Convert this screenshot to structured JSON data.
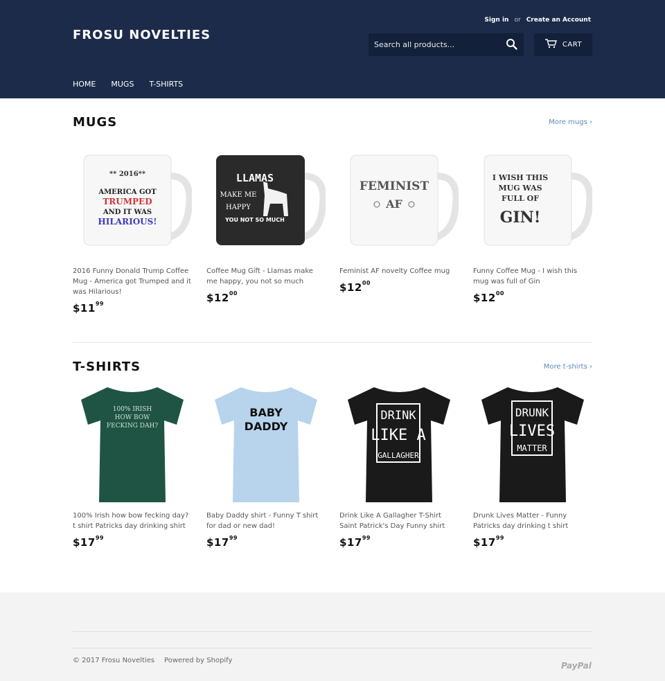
{
  "header": {
    "logo": "FROSU NOVELTIES",
    "sign_in": "Sign in",
    "or": "or",
    "create_account": "Create an Account",
    "search_placeholder": "Search all products...",
    "cart_label": "CART"
  },
  "nav": [
    "HOME",
    "MUGS",
    "T-SHIRTS"
  ],
  "mugs": {
    "title": "MUGS",
    "more": "More mugs ›",
    "products": [
      {
        "title": "2016 Funny Donald Trump Coffee Mug - America got Trumped and it was Hilarious!",
        "price_main": "$11",
        "price_cents": "99",
        "print": [
          "** 2016**",
          "AMERICA GOT",
          "TRUMPED",
          "AND IT WAS",
          "HILARIOUS!"
        ]
      },
      {
        "title": "Coffee Mug Gift - Llamas make me happy, you not so much",
        "price_main": "$12",
        "price_cents": "00",
        "print": [
          "LLAMAS",
          "MAKE ME",
          "HAPPY",
          "YOU NOT SO MUCH"
        ]
      },
      {
        "title": "Feminist AF novelty Coffee mug",
        "price_main": "$12",
        "price_cents": "00",
        "print": [
          "FEMINIST",
          "AF"
        ]
      },
      {
        "title": "Funny Coffee Mug - I wish this mug was full of Gin",
        "price_main": "$12",
        "price_cents": "00",
        "print": [
          "I WISH THIS",
          "MUG WAS",
          "FULL OF",
          "GIN!"
        ]
      }
    ]
  },
  "tshirts": {
    "title": "T-SHIRTS",
    "more": "More t-shirts ›",
    "products": [
      {
        "title": "100% Irish how bow fecking day? t shirt Patricks day drinking shirt",
        "price_main": "$17",
        "price_cents": "99",
        "color": "#1f5444",
        "print": [
          "100% IRISH",
          "HOW BOW",
          "FECKING DAH?"
        ]
      },
      {
        "title": "Baby Daddy shirt - Funny T shirt for dad or new dad!",
        "price_main": "$17",
        "price_cents": "99",
        "color": "#b8d4ec",
        "print": [
          "BABY",
          "DADDY"
        ]
      },
      {
        "title": "Drink Like A Gallagher T-Shirt Saint Patrick's Day Funny shirt",
        "price_main": "$17",
        "price_cents": "99",
        "color": "#1a1a1a",
        "print": [
          "DRINK",
          "LIKE A",
          "GALLAGHER"
        ]
      },
      {
        "title": "Drunk Lives Matter - Funny Patricks day drinking t shirt",
        "price_main": "$17",
        "price_cents": "99",
        "color": "#1a1a1a",
        "print": [
          "DRUNK",
          "LIVES",
          "MATTER"
        ]
      }
    ]
  },
  "footer": {
    "copyright": "© 2017 Frosu Novelties",
    "powered": "Powered by Shopify",
    "payment": "PayPal"
  },
  "colors": {
    "header_bg": "#1c2b4a",
    "link": "#5b8ab5",
    "footer_bg": "#f3f3f3"
  }
}
